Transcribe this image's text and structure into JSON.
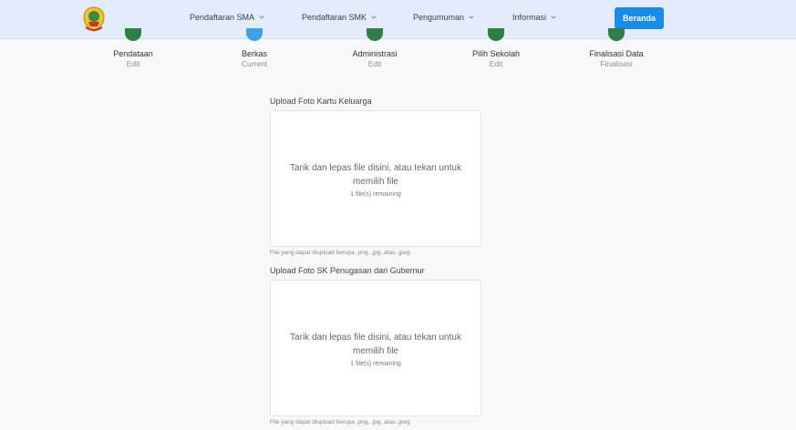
{
  "nav": {
    "items": [
      {
        "label": "Pendaftaran SMA"
      },
      {
        "label": "Pendaftaran SMK"
      },
      {
        "label": "Pengumuman"
      },
      {
        "label": "Informasi"
      }
    ],
    "home_button": "Beranda"
  },
  "steps": [
    {
      "label": "Pendataan",
      "status": "Edit"
    },
    {
      "label": "Berkas",
      "status": "Current"
    },
    {
      "label": "Administrasi",
      "status": "Edit"
    },
    {
      "label": "Pilih Sekolah",
      "status": "Edit"
    },
    {
      "label": "Finalisasi Data",
      "status": "Finalisasi"
    }
  ],
  "uploads": [
    {
      "title": "Upload Foto Kartu Keluarga",
      "drop_text": "Tarik dan lepas file disini, atau tekan untuk memilih file",
      "remaining": "1 file(s) remaining",
      "hint": "File yang dapat diupload berupa .png, .jpg, atau .jpeg"
    },
    {
      "title": "Upload Foto SK Penugasan dari Gubernur",
      "drop_text": "Tarik dan lepas file disini, atau tekan untuk memilih file",
      "remaining": "1 file(s) remaining",
      "hint": "File yang dapat diupload berupa .png, .jpg, atau .jpeg"
    }
  ],
  "colors": {
    "navbar_bg": "#e2ecfb",
    "accent": "#1a8be6",
    "step_done": "#2f7d47",
    "step_current": "#3ea3e8"
  }
}
